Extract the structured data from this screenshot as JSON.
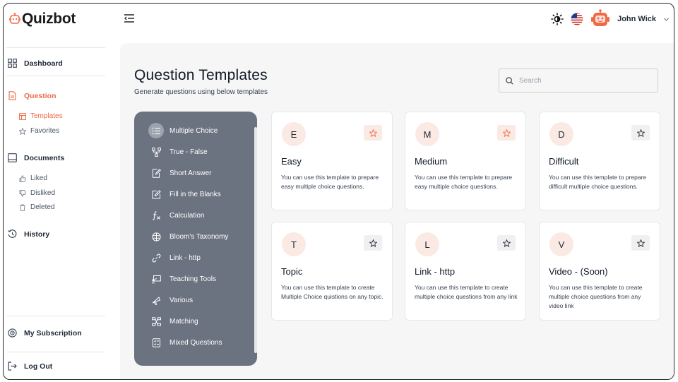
{
  "brand": {
    "name": "Quizbot",
    "accent": "#ef6a44"
  },
  "header": {
    "user_name": "John Wick"
  },
  "sidebar": {
    "dashboard": "Dashboard",
    "question": "Question",
    "templates": "Templates",
    "favorites": "Favorites",
    "documents": "Documents",
    "liked": "Liked",
    "disliked": "Disliked",
    "deleted": "Deleted",
    "history": "History",
    "subscription": "My Subscription",
    "logout": "Log Out"
  },
  "main": {
    "title": "Question Templates",
    "subtitle": "Generate questions using below templates",
    "search_placeholder": "Search"
  },
  "question_types": [
    "Multiple Choice",
    "True - False",
    "Short Answer",
    "Fill in the Blanks",
    "Calculation",
    "Bloom's Taxonomy",
    "Link - http",
    "Teaching Tools",
    "Various",
    "Matching",
    "Mixed Questions"
  ],
  "cards": [
    {
      "letter": "E",
      "title": "Easy",
      "desc": "You can use this template to prepare easy multiple choice questions.",
      "favorite": true
    },
    {
      "letter": "M",
      "title": "Medium",
      "desc": "You can use this template to prepare easy multiple choice questions.",
      "favorite": true
    },
    {
      "letter": "D",
      "title": "Difficult",
      "desc": "You can use this template to prepare difficult multiple choice questions.",
      "favorite": false
    },
    {
      "letter": "T",
      "title": "Topic",
      "desc": "You can use this template to create Multiple Choice quistions on any topic.",
      "favorite": false
    },
    {
      "letter": "L",
      "title": "Link - http",
      "desc": "You can use this template to create multiple choice questions from any link",
      "favorite": false
    },
    {
      "letter": "V",
      "title": "Video - (Soon)",
      "desc": "You can use this template to create multiple choice questions from any video link",
      "favorite": false
    }
  ]
}
